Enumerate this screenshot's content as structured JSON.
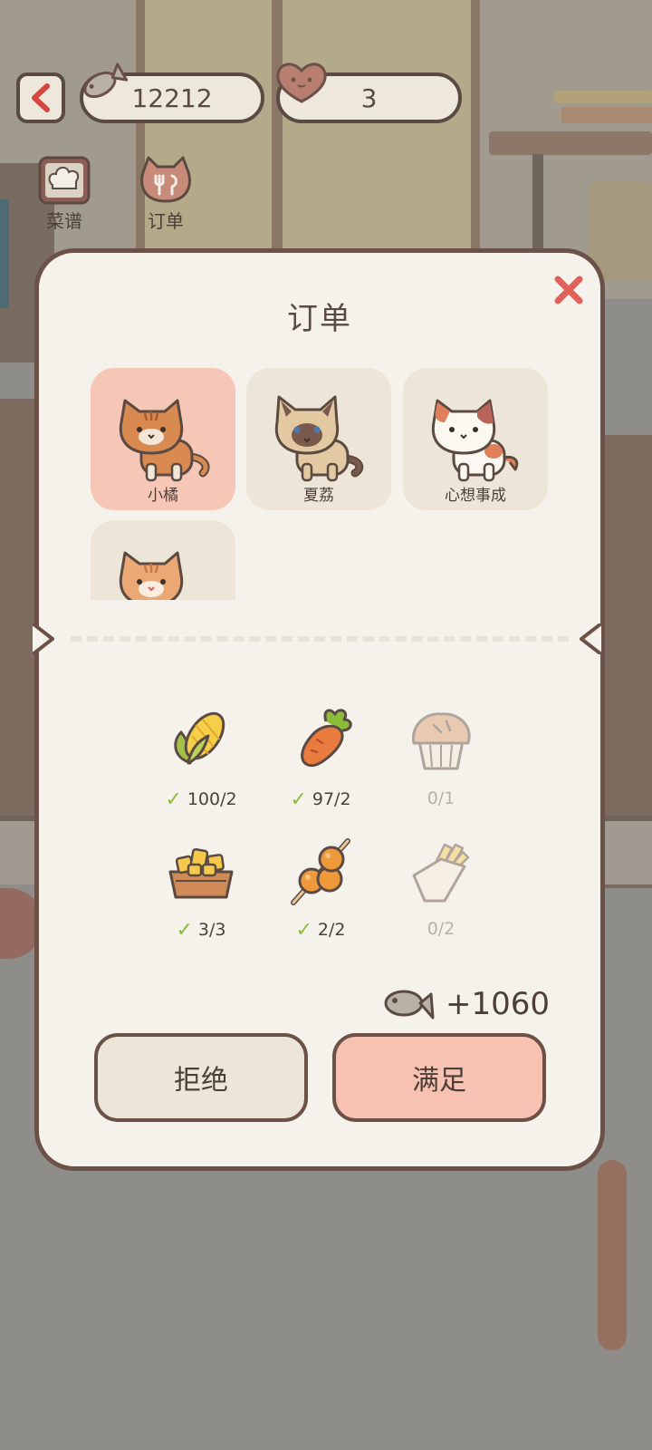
{
  "hud": {
    "fish_currency": "12212",
    "heart_currency": "3"
  },
  "nav": {
    "recipes_label": "菜谱",
    "orders_label": "订单"
  },
  "modal": {
    "title": "订单",
    "cats": [
      {
        "name": "小橘",
        "selected": true
      },
      {
        "name": "夏荔",
        "selected": false
      },
      {
        "name": "心想事成",
        "selected": false
      },
      {
        "name": "",
        "selected": false
      }
    ],
    "items": [
      {
        "icon": "corn-icon",
        "count": "100/2",
        "fulfilled": true
      },
      {
        "icon": "carrot-icon",
        "count": "97/2",
        "fulfilled": true
      },
      {
        "icon": "muffin-icon",
        "count": "0/1",
        "fulfilled": false
      },
      {
        "icon": "popcorn-chicken-icon",
        "count": "3/3",
        "fulfilled": true
      },
      {
        "icon": "meatball-skewer-icon",
        "count": "2/2",
        "fulfilled": true
      },
      {
        "icon": "fries-icon",
        "count": "0/2",
        "fulfilled": false
      }
    ],
    "reward": "+1060",
    "reject_label": "拒绝",
    "accept_label": "满足"
  },
  "colors": {
    "accent_pink": "#f8c2b2",
    "border_brown": "#6b5148",
    "check_green": "#8cbd3a",
    "close_red": "#e0605a"
  }
}
